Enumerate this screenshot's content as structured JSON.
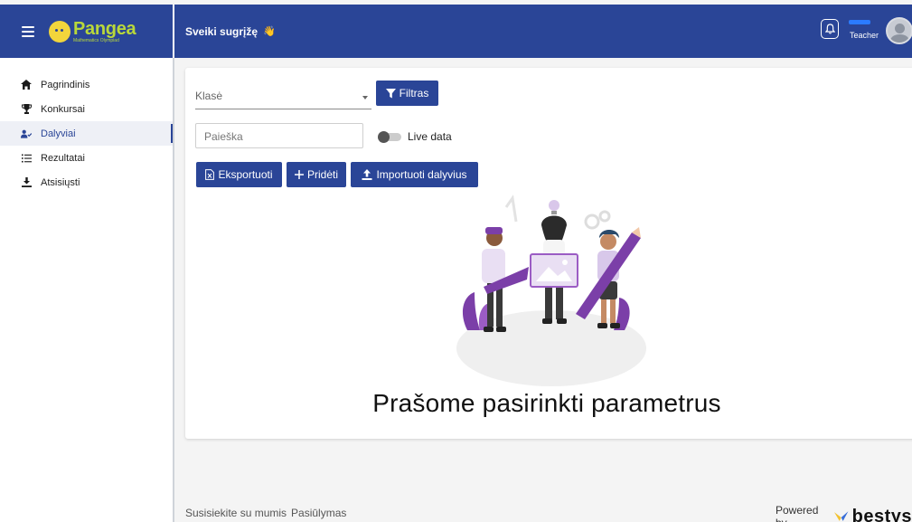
{
  "app": {
    "logo_name": "Pangea",
    "logo_sub": "Mathematics Olympiad"
  },
  "header": {
    "greeting": "Sveiki sugrįžę",
    "wave_icon": "👋",
    "user_role": "Teacher"
  },
  "sidebar": {
    "items": [
      {
        "label": "Pagrindinis",
        "icon": "home-icon"
      },
      {
        "label": "Konkursai",
        "icon": "trophy-icon"
      },
      {
        "label": "Dalyviai",
        "icon": "people-icon",
        "active": true
      },
      {
        "label": "Rezultatai",
        "icon": "list-ordered-icon"
      },
      {
        "label": "Atsisiųsti",
        "icon": "download-icon"
      }
    ]
  },
  "filters": {
    "class_placeholder": "Klasė",
    "filter_button": "Filtras",
    "search_placeholder": "Paieška",
    "live_label": "Live data",
    "live_enabled": false
  },
  "actions": {
    "export": "Eksportuoti",
    "add": "Pridėti",
    "import": "Importuoti dalyvius"
  },
  "main": {
    "empty_message": "Prašome pasirinkti parametrus"
  },
  "footer": {
    "contact": "Susisiekite su mumis",
    "suggestions": "Pasiūlymas",
    "powered_by": "Powered by",
    "brand": "bestys"
  },
  "colors": {
    "primary": "#2a4597",
    "illustration_accent": "#7b3fa8",
    "logo": "#b9d83a"
  }
}
